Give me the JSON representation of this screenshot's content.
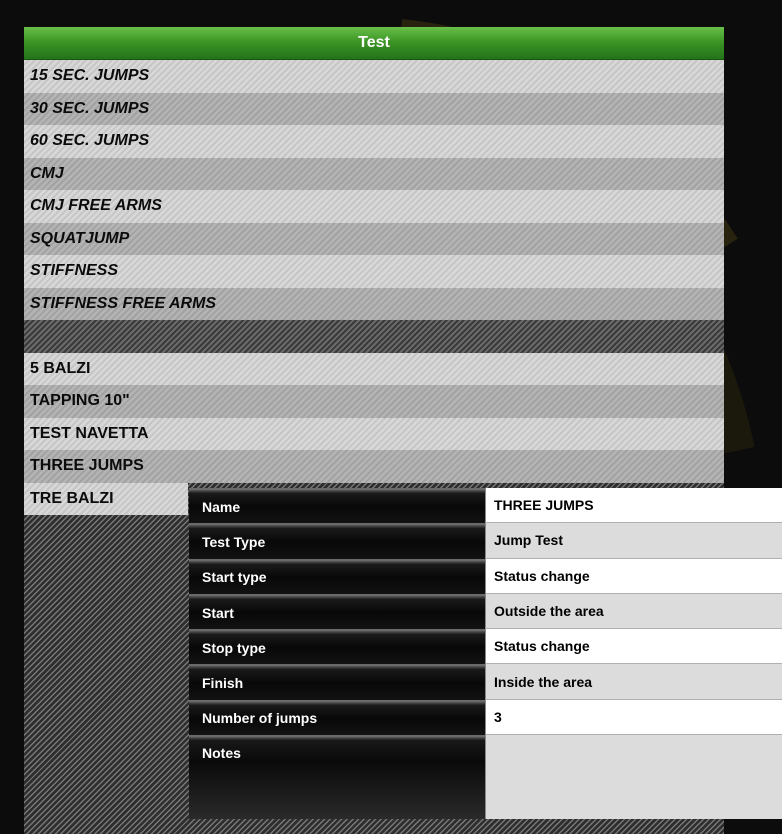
{
  "header": {
    "title": "Test"
  },
  "tests": [
    {
      "label": "15 SEC. JUMPS",
      "italic": true
    },
    {
      "label": "30 SEC. JUMPS",
      "italic": true
    },
    {
      "label": "60 SEC. JUMPS",
      "italic": true
    },
    {
      "label": "CMJ",
      "italic": true
    },
    {
      "label": "CMJ FREE ARMS",
      "italic": true
    },
    {
      "label": "SQUATJUMP",
      "italic": true
    },
    {
      "label": "STIFFNESS",
      "italic": true
    },
    {
      "label": "STIFFNESS FREE ARMS",
      "italic": true
    },
    {
      "label": "",
      "italic": false
    },
    {
      "label": "5 BALZI",
      "italic": false
    },
    {
      "label": "TAPPING 10\"",
      "italic": false
    },
    {
      "label": "TEST NAVETTA",
      "italic": false
    },
    {
      "label": "THREE JUMPS",
      "italic": false
    },
    {
      "label": "TRE BALZI",
      "italic": false
    }
  ],
  "details": {
    "name_label": "Name",
    "name_value": "THREE JUMPS",
    "type_label": "Test Type",
    "type_value": "Jump Test",
    "start_type_label": "Start type",
    "start_type_value": "Status change",
    "start_label": "Start",
    "start_value": "Outside the area",
    "stop_type_label": "Stop type",
    "stop_type_value": "Status change",
    "finish_label": "Finish",
    "finish_value": "Inside the area",
    "jumps_label": "Number of jumps",
    "jumps_value": "3",
    "notes_label": "Notes",
    "notes_value": ""
  }
}
